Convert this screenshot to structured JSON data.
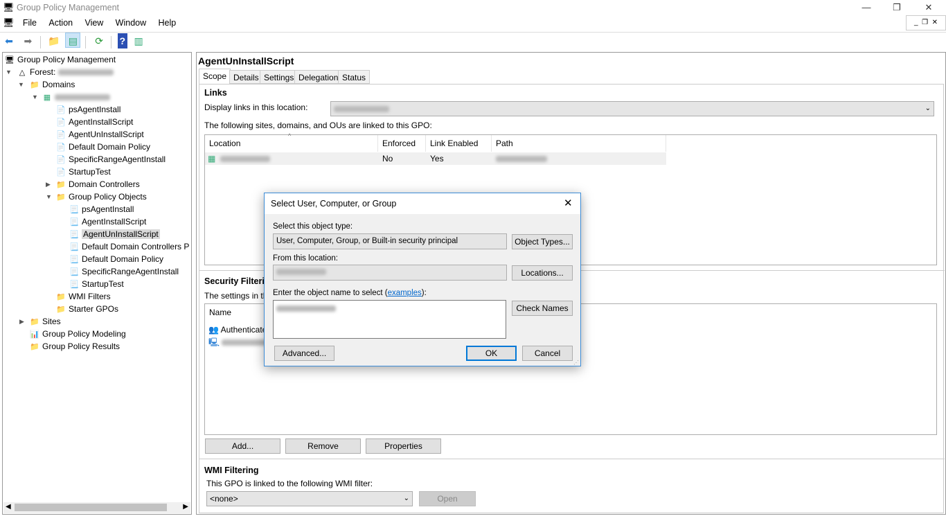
{
  "window": {
    "title": "Group Policy Management",
    "minimize": "—",
    "restore": "❐",
    "close": "✕"
  },
  "menu": [
    "File",
    "Action",
    "View",
    "Window",
    "Help"
  ],
  "tree": {
    "root": "Group Policy Management",
    "forest": "Forest:",
    "domains": "Domains",
    "linked": [
      "psAgentInstall",
      "AgentInstallScript",
      "AgentUnInstallScript",
      "Default Domain Policy",
      "SpecificRangeAgentInstall",
      "StartupTest"
    ],
    "domain_controllers": "Domain Controllers",
    "gpo_folder": "Group Policy Objects",
    "gpos": [
      "psAgentInstall",
      "AgentInstallScript",
      "AgentUnInstallScript",
      "Default Domain Controllers P",
      "Default Domain Policy",
      "SpecificRangeAgentInstall",
      "StartupTest"
    ],
    "wmi_filters": "WMI Filters",
    "starter": "Starter GPOs",
    "sites": "Sites",
    "modeling": "Group Policy Modeling",
    "results": "Group Policy Results"
  },
  "main": {
    "title": "AgentUnInstallScript",
    "tabs": [
      "Scope",
      "Details",
      "Settings",
      "Delegation",
      "Status"
    ],
    "links_heading": "Links",
    "display_links_label": "Display links in this location:",
    "linked_text": "The following sites, domains, and OUs are linked to this GPO:",
    "links_columns": [
      "Location",
      "Enforced",
      "Link Enabled",
      "Path"
    ],
    "links_row": {
      "enforced": "No",
      "link_enabled": "Yes"
    },
    "security_heading": "Security Filtering",
    "security_text": "The settings in this",
    "security_column": "Name",
    "security_rows": [
      "Authenticated"
    ],
    "buttons": {
      "add": "Add...",
      "remove": "Remove",
      "properties": "Properties"
    },
    "wmi_heading": "WMI Filtering",
    "wmi_text": "This GPO is linked to the following WMI filter:",
    "wmi_value": "<none>",
    "open": "Open"
  },
  "dialog": {
    "title": "Select User, Computer, or Group",
    "object_type_label": "Select this object type:",
    "object_type_value": "User, Computer, Group, or Built-in security principal",
    "object_types_btn": "Object Types...",
    "location_label": "From this location:",
    "locations_btn": "Locations...",
    "enter_label_pre": "Enter the object name to select (",
    "examples_link": "examples",
    "enter_label_post": "):",
    "check_names": "Check Names",
    "advanced": "Advanced...",
    "ok": "OK",
    "cancel": "Cancel",
    "close": "✕"
  }
}
